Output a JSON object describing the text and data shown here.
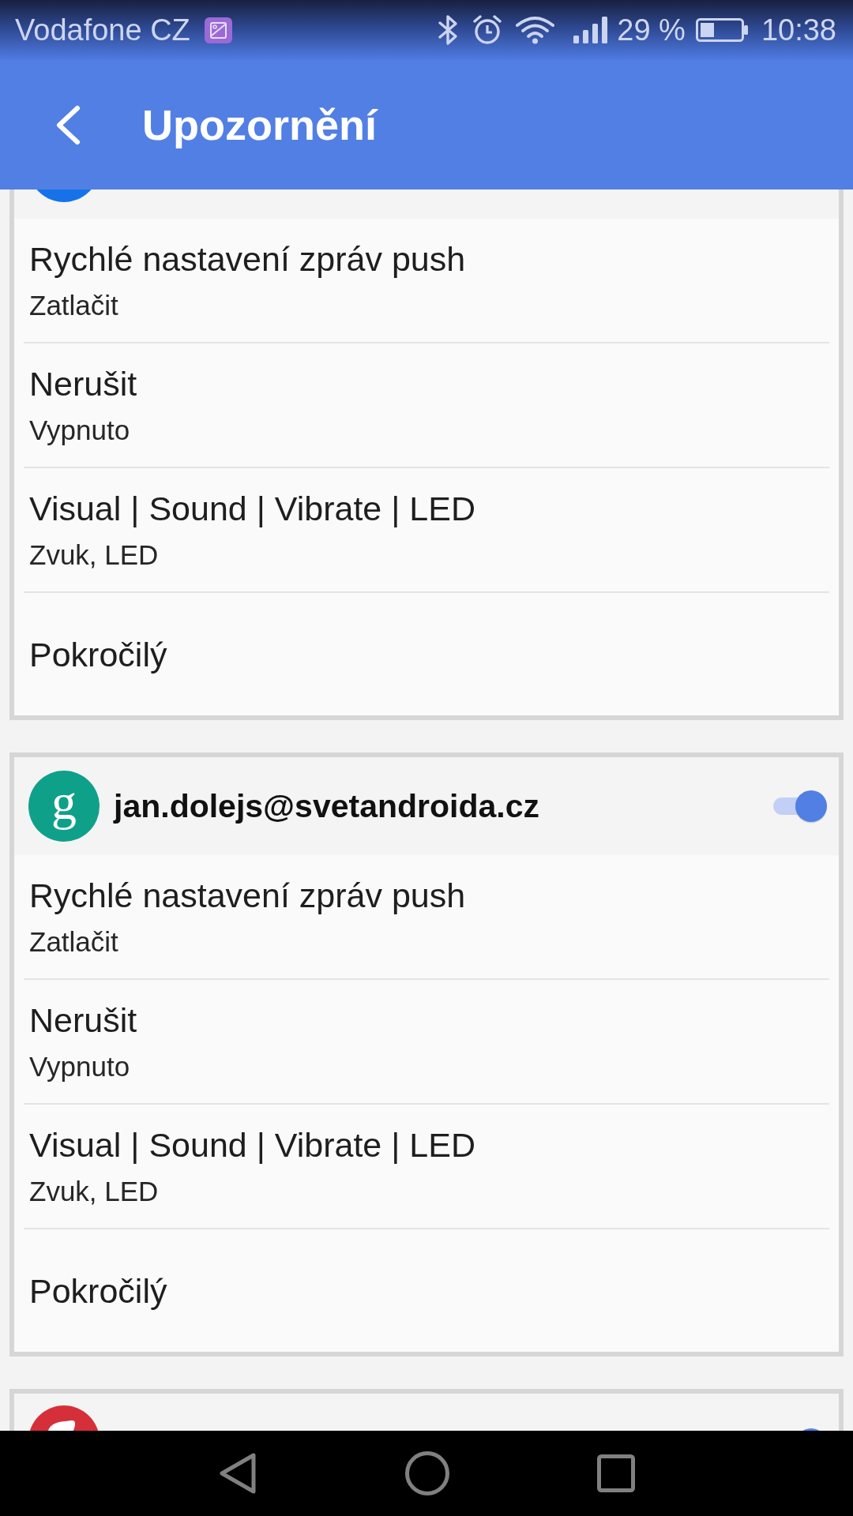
{
  "status_bar": {
    "carrier": "Vodafone CZ",
    "battery": "29 %",
    "time": "10:38"
  },
  "app_bar": {
    "title": "Upozornění"
  },
  "accounts": [
    {
      "color": "#1672e8",
      "settings": [
        {
          "title": "Rychlé nastavení zpráv push",
          "value": "Zatlačit"
        },
        {
          "title": "Nerušit",
          "value": "Vypnuto"
        },
        {
          "title": "Visual | Sound | Vibrate | LED",
          "value": "Zvuk, LED"
        },
        {
          "title": "Pokročilý"
        }
      ]
    },
    {
      "color": "#0fa08a",
      "avatar_letter": "g",
      "email": "jan.dolejs@svetandroida.cz",
      "on": true,
      "settings": [
        {
          "title": "Rychlé nastavení zpráv push",
          "value": "Zatlačit"
        },
        {
          "title": "Nerušit",
          "value": "Vypnuto"
        },
        {
          "title": "Visual | Sound | Vibrate | LED",
          "value": "Zvuk, LED"
        },
        {
          "title": "Pokročilý"
        }
      ]
    },
    {
      "color": "#d5303a",
      "on": true
    }
  ]
}
